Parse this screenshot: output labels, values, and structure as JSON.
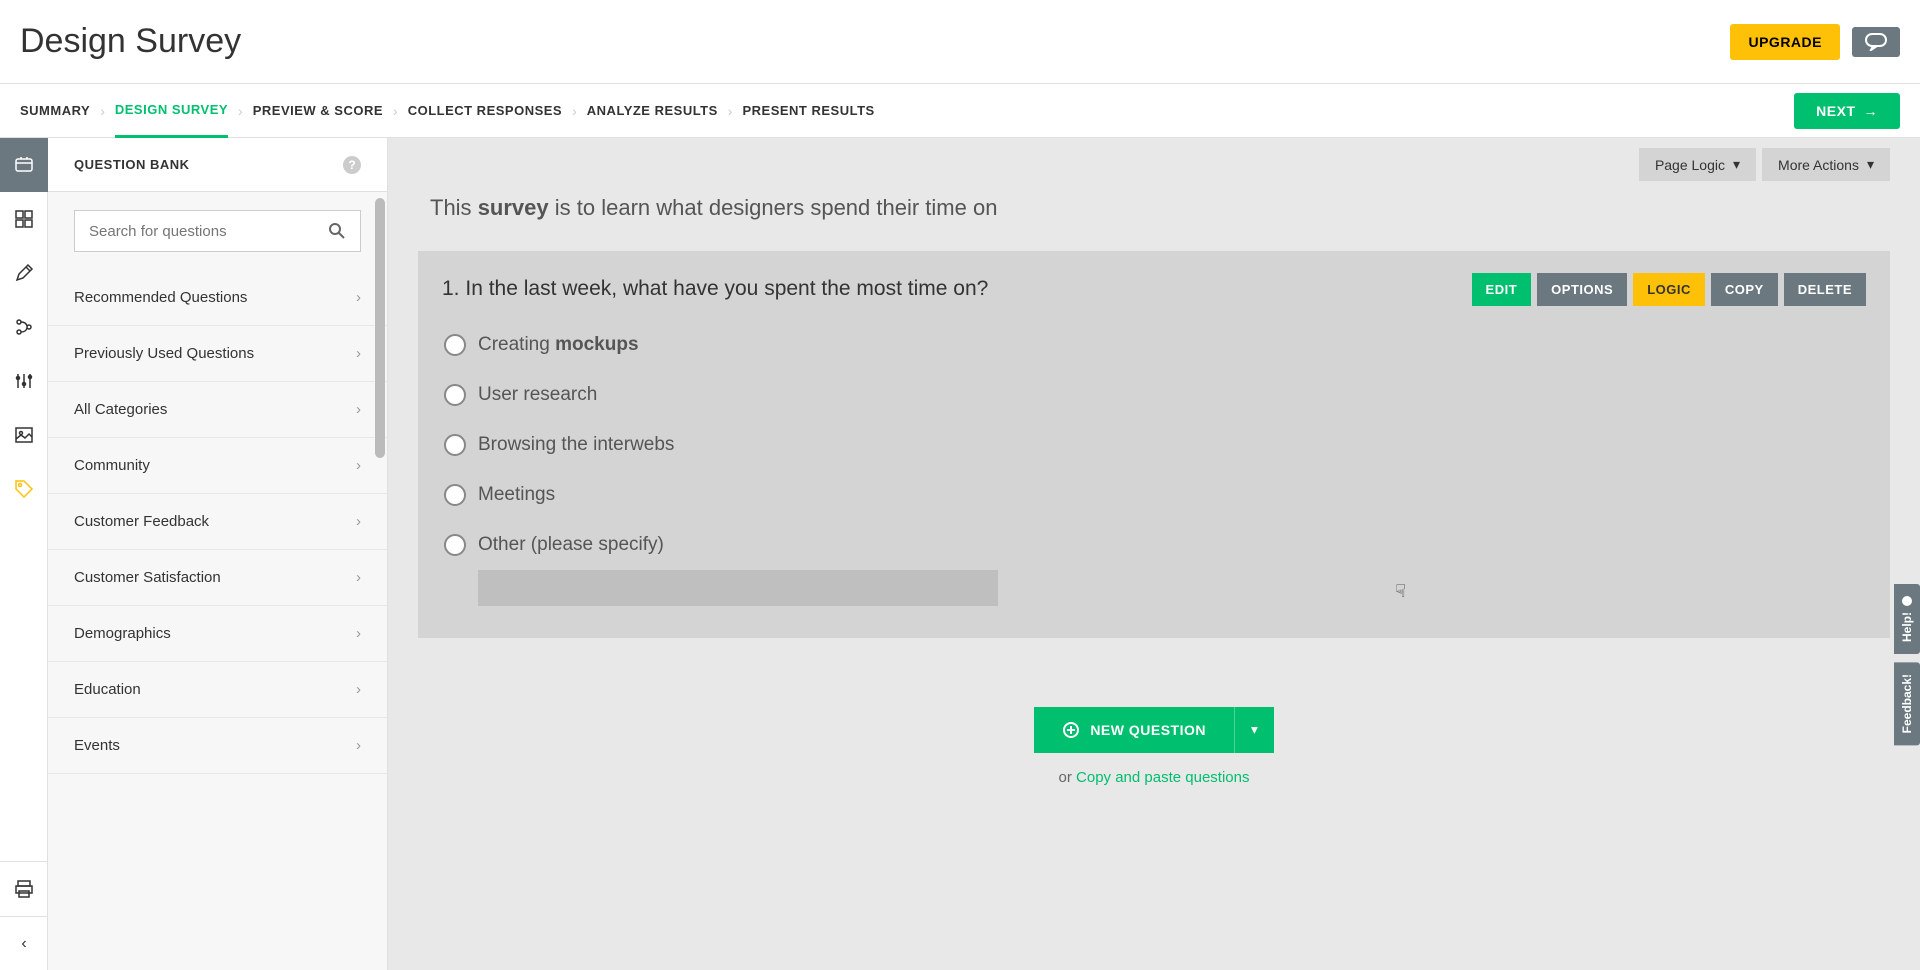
{
  "header": {
    "title": "Design Survey",
    "upgrade": "UPGRADE"
  },
  "nav": {
    "steps": [
      "SUMMARY",
      "DESIGN SURVEY",
      "PREVIEW & SCORE",
      "COLLECT RESPONSES",
      "ANALYZE RESULTS",
      "PRESENT RESULTS"
    ],
    "active_index": 1,
    "next": "NEXT"
  },
  "sidebar": {
    "title": "QUESTION BANK",
    "search_placeholder": "Search for questions",
    "categories": [
      "Recommended Questions",
      "Previously Used Questions",
      "All Categories",
      "Community",
      "Customer Feedback",
      "Customer Satisfaction",
      "Demographics",
      "Education",
      "Events"
    ]
  },
  "page_actions": {
    "logic": "Page Logic",
    "more": "More Actions"
  },
  "intro": {
    "prefix": "This ",
    "bold": "survey",
    "suffix": " is to learn what designers spend their time on"
  },
  "question": {
    "number": "1.",
    "text": "In the last week, what have you spent the most time on?",
    "buttons": {
      "edit": "EDIT",
      "options": "OPTIONS",
      "logic": "LOGIC",
      "copy": "COPY",
      "delete": "DELETE"
    },
    "options": [
      {
        "prefix": "Creating ",
        "bold": "mockups",
        "suffix": ""
      },
      {
        "prefix": "User research",
        "bold": "",
        "suffix": ""
      },
      {
        "prefix": "Browsing the interwebs",
        "bold": "",
        "suffix": ""
      },
      {
        "prefix": "Meetings",
        "bold": "",
        "suffix": ""
      },
      {
        "prefix": "Other (please specify)",
        "bold": "",
        "suffix": ""
      }
    ]
  },
  "new_question": {
    "label": "NEW QUESTION",
    "or": "or ",
    "paste": "Copy and paste questions"
  },
  "side_tabs": {
    "help": "Help!",
    "feedback": "Feedback!"
  },
  "colors": {
    "primary": "#00bf6f",
    "accent": "#ffc107",
    "gray": "#6b787f"
  }
}
